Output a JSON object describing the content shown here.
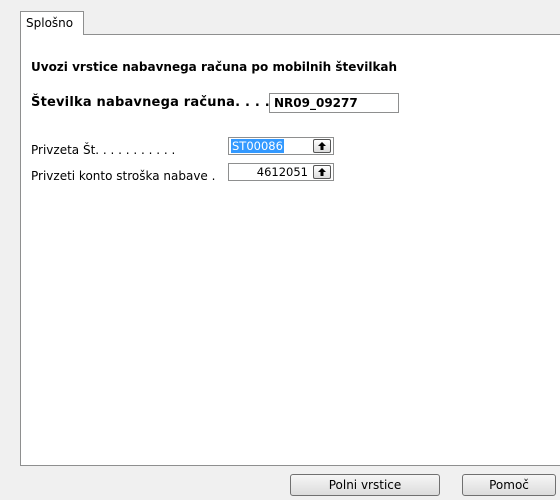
{
  "tab": {
    "label": "Splošno"
  },
  "heading": "Uvozi vrstice nabavnega računa po mobilnih številkah",
  "invoice": {
    "label": "Številka nabavnega računa. . . .",
    "value": "NR09_09277"
  },
  "fields": [
    {
      "label": "Privzeta Št. . . . . . . . . . .",
      "value": "ST00086",
      "selected": true,
      "lookup_icon": "up-arrow-icon"
    },
    {
      "label": "Privzeti konto stroška nabave  .",
      "value": "4612051",
      "selected": false,
      "lookup_icon": "up-arrow-icon"
    }
  ],
  "buttons": {
    "fill_lines": "Polni vrstice",
    "help": "Pomoč"
  },
  "colors": {
    "selection": "#3399ff",
    "border": "#8e8f8f",
    "background": "#f0f0f0"
  }
}
